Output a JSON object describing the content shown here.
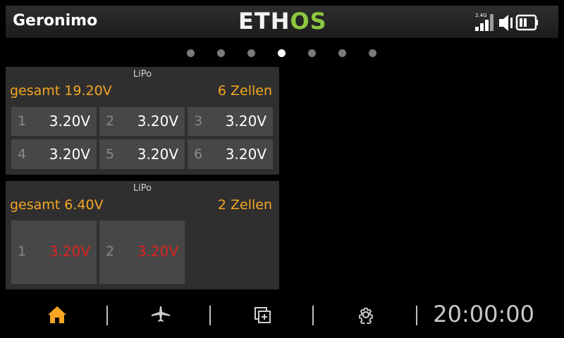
{
  "header": {
    "model_name": "Geronimo",
    "logo_left": "ETH",
    "logo_right": "OS",
    "rf_band": "2.4G"
  },
  "pages": {
    "count": 7,
    "active_index": 3
  },
  "widgets": [
    {
      "title": "LiPo",
      "total": "gesamt 19.20V",
      "cells_count": "6 Zellen",
      "cells": [
        {
          "num": "1",
          "value": "3.20V"
        },
        {
          "num": "2",
          "value": "3.20V"
        },
        {
          "num": "3",
          "value": "3.20V"
        },
        {
          "num": "4",
          "value": "3.20V"
        },
        {
          "num": "5",
          "value": "3.20V"
        },
        {
          "num": "6",
          "value": "3.20V"
        }
      ]
    },
    {
      "title": "LiPo",
      "total": "gesamt 6.40V",
      "cells_count": "2 Zellen",
      "cells": [
        {
          "num": "1",
          "value": "3.20V"
        },
        {
          "num": "2",
          "value": "3.20V"
        }
      ]
    }
  ],
  "footer": {
    "nav": [
      "home-icon",
      "airplane-icon",
      "layers-icon",
      "gear-icon"
    ],
    "clock": "20:00:00"
  },
  "colors": {
    "accent": "#f5a623",
    "active_nav": "#f5a623",
    "alarm": "#e02020",
    "logo_green": "#8cc63f"
  }
}
